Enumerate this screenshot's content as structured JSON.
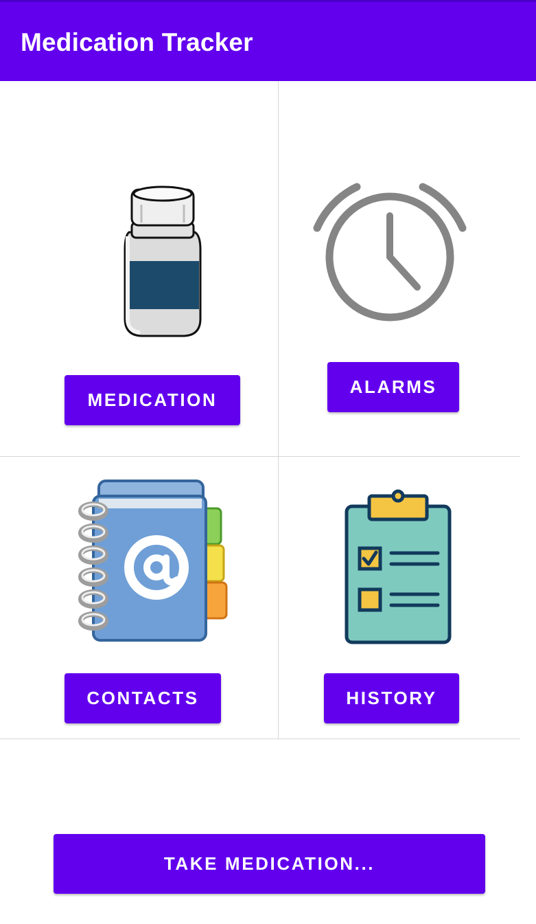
{
  "app": {
    "title": "Medication Tracker"
  },
  "theme": {
    "primary": "#6200EE",
    "divider": "#d6d6d6"
  },
  "tiles": {
    "medication": {
      "icon": "pill-bottle-icon",
      "button_label": "MEDICATION"
    },
    "alarms": {
      "icon": "alarm-clock-icon",
      "button_label": "ALARMS"
    },
    "contacts": {
      "icon": "address-book-icon",
      "button_label": "CONTACTS"
    },
    "history": {
      "icon": "clipboard-checklist-icon",
      "button_label": "HISTORY"
    }
  },
  "primary_action": {
    "label": "TAKE MEDICATION..."
  }
}
